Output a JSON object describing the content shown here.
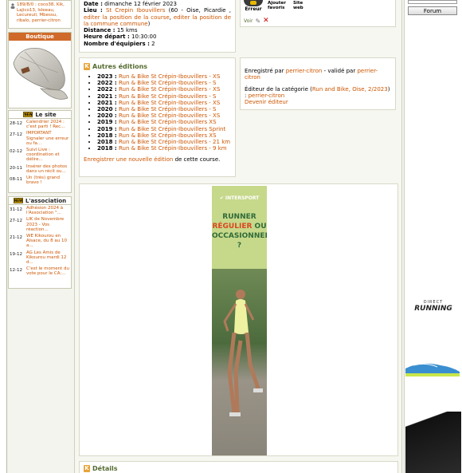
{
  "left": {
    "member_line": "189/8/0 : coco38, Kik, Lajico13, lsleeau, Lecureuil, Mbessu, ribalo, perrier-citron",
    "boutique_title": "Boutique",
    "site_title": "Le site",
    "site_news": [
      {
        "date": "28-12",
        "text": "Calendrier 2024 : c'est parti ! Rec..."
      },
      {
        "date": "27-12",
        "text": "IMPORTANT Signaler une erreur ou fa..."
      },
      {
        "date": "02-12",
        "text": "Suivi Live : coordination et délire..."
      },
      {
        "date": "20-11",
        "text": "Insérer des photos dans un récit ou..."
      },
      {
        "date": "08-11",
        "text": "Un (très) grand bravo !"
      }
    ],
    "assoc_title": "L'association",
    "assoc_news": [
      {
        "date": "31-12",
        "text": "Adhésion 2024 à l'Association \"..."
      },
      {
        "date": "27-12",
        "text": "LIK de Novembre 2023 - Vos réaction..."
      },
      {
        "date": "21-12",
        "text": "WE Kikourou en Alsace, du 8 au 10 a..."
      },
      {
        "date": "19-12",
        "text": "AG Les Amis de Kikourou mardi 12 d..."
      },
      {
        "date": "12-12",
        "text": "C'est le moment du vote pour le CA:..."
      }
    ]
  },
  "race": {
    "date_label": "Date :",
    "date_value": "dimanche 12 février 2023",
    "lieu_label": "Lieu :",
    "lieu_link": "St Crepin Ibouvillers",
    "lieu_rest": "(60 - Oise, Picardie ,",
    "lieu_link2": "commune",
    "lieu_end": ")",
    "edit_link1": "editer la position de la course",
    "edit_link2": "editer la position de la commune",
    "distance_label": "Distance :",
    "distance_value": "15 kms",
    "heure_label": "Heure départ :",
    "heure_value": "10:30:00",
    "equipiers_label": "Nombre d'équipiers :",
    "equipiers_value": "2"
  },
  "actions": {
    "erreur": "Erreur",
    "favoris": "Ajouter favoris",
    "site_web": "Site web",
    "voir": "Voir"
  },
  "editions": {
    "title": "Autres éditions",
    "items": [
      {
        "year": "2023 :",
        "name": "Run & Bike St Crépin-Ibouvillers - XS"
      },
      {
        "year": "2022 :",
        "name": "Run & Bike St Crépin-Ibouvillers - S"
      },
      {
        "year": "2022 :",
        "name": "Run & Bike St Crépin-Ibouvillers - XS"
      },
      {
        "year": "2021 :",
        "name": "Run & Bike St Crépin-Ibouvillers - S"
      },
      {
        "year": "2021 :",
        "name": "Run & Bike St Crépin-Ibouvillers - XS"
      },
      {
        "year": "2020 :",
        "name": "Run & Bike St Crépin-Ibouvillers - S"
      },
      {
        "year": "2020 :",
        "name": "Run & Bike St Crépin-Ibouvillers - XS"
      },
      {
        "year": "2019 :",
        "name": "Run & Bike St Crépin-Ibouvillers XS"
      },
      {
        "year": "2019 :",
        "name": "Run & Bike St Crépin-Ibouvillers Sprint"
      },
      {
        "year": "2018 :",
        "name": "Run & Bike St Crépin-Ibouvillers XS"
      },
      {
        "year": "2018 :",
        "name": "Run & Bike St Crépin-Ibouvillers - 21 km"
      },
      {
        "year": "2018 :",
        "name": "Run & Bike St Crépin-Ibouvillers - 9 km"
      }
    ],
    "register_link": "Enregistrer une nouvelle édition",
    "register_rest": " de cette course."
  },
  "info": {
    "enreg_pre": "Enregistré par ",
    "enreg_user": "perrier-citron",
    "valide_pre": " - validé par ",
    "valide_user": "perrier-citron",
    "editeur_pre": "Éditeur de la catégorie (",
    "editeur_cat": "Run and Bike, Oise, 2/2023",
    "editeur_post": ")",
    "editeur_colon": ": ",
    "editeur_user": "perrier-citron",
    "devenir": "Devenir éditeur"
  },
  "ad": {
    "brand": "INTERSPORT",
    "line1": "RUNNER",
    "line2a": "RÉGULIER",
    "line2b": "OU",
    "line3": "OCCASIONNEL ?",
    "right_brand_top": "DIRECT",
    "right_brand": "RUNNING"
  },
  "details": {
    "title": "Détails"
  },
  "right": {
    "forum": "Forum"
  },
  "colors": {
    "accent": "#cc5500",
    "olive": "#556b2f",
    "ad_green": "#c6d88a"
  }
}
